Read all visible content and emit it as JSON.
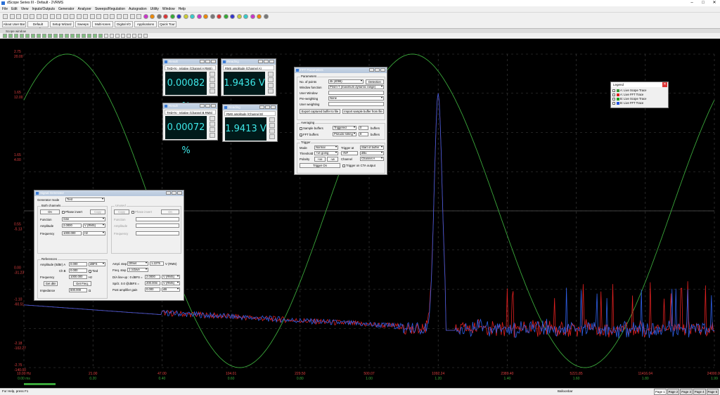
{
  "app": {
    "title": "dScope Series III - Default - 2VRMS"
  },
  "menu": [
    "File",
    "Edit",
    "View",
    "Inputs/Outputs",
    "Generator",
    "Analyzer",
    "Sweeps/Regulation",
    "Autogration",
    "Utility",
    "Window",
    "Help"
  ],
  "toolbar2": [
    "About User Bar",
    "Default Config",
    "Setup Wizard",
    "Sweeps",
    "Multi-tones",
    "Digital I/O",
    "Applications",
    "Quick Tour"
  ],
  "mdi": {
    "title": "Scope window"
  },
  "status": {
    "help": "For Help, press F1",
    "balloon": "Balloonbar",
    "pages": [
      "Page 1",
      "Page 2",
      "Page 3",
      "Page 4",
      "Page 5"
    ]
  },
  "readings": [
    {
      "title": "Result",
      "label": "THD+N - relative (Channel A RMS)",
      "value": "0.00082 %"
    },
    {
      "title": "Reading",
      "label": "RMS amplitude (Channel A)",
      "value": "1.9436 V"
    },
    {
      "title": "Result",
      "label": "THD+N - relative (Channel B RMS)",
      "value": "0.00072 %"
    },
    {
      "title": "Reading",
      "label": "RMS amplitude (Channel B)",
      "value": "1.9413 V"
    }
  ],
  "fft": {
    "title": "FFT Parameters",
    "params_label": "Parameters",
    "points_label": "No. of points",
    "points": "4k (4096)",
    "detection": "Detection",
    "window_label": "Window function",
    "window": "Prism-7 (maximum dynamic range)",
    "userwin_label": "User Window",
    "preweight_label": "Pre-weighting",
    "preweight": "None",
    "userweight_label": "User weighting",
    "export_btn": "Export captured buffer to file",
    "import_btn": "Import sample buffer from file",
    "avg_label": "Averaging",
    "sample_label": "Sample buffers",
    "sample_mode": "Triggered",
    "sample_n": "0",
    "buffers": "buffers",
    "fftbuf_label": "FFT buffers",
    "fftbuf_mode": "Pseudo-rolling",
    "fftbuf_n": "8",
    "trig_label": "Trigger",
    "mode_label": "Mode",
    "mode": "Normal",
    "trigat_label": "Trigger at",
    "trigat": "Start of buffer",
    "thresh_label": "Threshold",
    "thresh": "+ve going",
    "thresh_v": "-INF",
    "thresh_u": "dBu",
    "pol_label": "Polarity",
    "pos": "+ve",
    "neg": "-ve",
    "chan_label": "Channel",
    "chan": "Channel A",
    "trigon": "Trigger On",
    "cta": "Trigger on CTA output"
  },
  "siggen": {
    "title": "Signal Generator",
    "mode_label": "Generator mode",
    "mode": "Tied",
    "both_label": "Both channels",
    "on": "On",
    "phase": "Phase invert",
    "copy": "Copy",
    "func_label": "Function",
    "func": "Sine",
    "amp_label": "Amplitude",
    "amp": "2.0000",
    "amp_u": "V (RMS)",
    "freq_label": "Frequency",
    "freq": "1000.000",
    "freq_u": "Hz",
    "unused_label": "Unused",
    "refs_label": "References",
    "ampref_label": "Amplitude (0dBr) A",
    "ampref": "0.000",
    "ampref_u": "dBFS",
    "chb_label": "Ch B",
    "chb": "0.000",
    "tied": "Tied",
    "fref_label": "Frequency",
    "fref": "1000.000",
    "fref_u": "Hz",
    "getdbr": "Get dBr",
    "getfreq": "Get Freq.",
    "imp_label": "Impedance",
    "imp": "600.000",
    "imp_u": "Ω",
    "ampstep_label": "Ampl. step",
    "ampstep": "Offset",
    "ampstep_v": "1.2275",
    "ampstep_u": "V (RMS)",
    "freqstep_label": "Freq. step",
    "freqstep": "1 octave",
    "da_label": "D/A line-up : 0 dBFS =",
    "da": "2.0000",
    "da_u": "V (RMS)",
    "spdif_label": "Sp/iz. 0.0 @dBFS =",
    "spdif": "200.00m",
    "spdif_u": "V (RMS)",
    "post_label": "Post amplifier gain",
    "post": "0.000",
    "post_u": "dB"
  },
  "legend": {
    "title": "Legend",
    "items": [
      {
        "label": "A: Live Scope Trace",
        "color": "#3a9a3a"
      },
      {
        "label": "A: Live FFT Trace",
        "color": "#e02020"
      },
      {
        "label": "B: Live Scope Trace",
        "color": "#20a020"
      },
      {
        "label": "B: Live FFT Trace",
        "color": "#2050e0"
      }
    ]
  },
  "axes": {
    "left_top": [
      "2.75",
      "20.00"
    ],
    "left_labels": [
      [
        "1.65",
        "12.00"
      ],
      [
        "1.65",
        "4.00"
      ],
      [
        "0.55",
        "-5.13"
      ],
      [
        "0.00",
        "-31.23"
      ],
      [
        "-1.10",
        "-60.51"
      ],
      [
        "-2.18",
        "-102.27"
      ],
      [
        "-2.75",
        "-140.00"
      ]
    ],
    "bottom_time": [
      "0.00 ms",
      "0.20",
      "0.40",
      "0.60",
      "0.80",
      "1.00",
      "1.20",
      "1.40",
      "1.60",
      "1.80",
      "1.99"
    ],
    "bottom_freq": [
      "10.00 Hz",
      "21.00",
      "47.00",
      "104.01",
      "229.50",
      "500.07",
      "1092.24",
      "2389.40",
      "5221.85",
      "11416.04",
      "24000.00"
    ]
  },
  "chart_data": {
    "type": "line",
    "series": [
      {
        "name": "A: Live Scope Trace",
        "color": "#3a9a3a",
        "cycles": 2.0,
        "amplitude": 2.75,
        "ylim": [
          -2.75,
          2.75
        ]
      },
      {
        "name": "A: Live FFT Trace",
        "color": "#e02020",
        "ylim": [
          -140,
          20
        ]
      },
      {
        "name": "B: Live FFT Trace",
        "color": "#2050e0",
        "ylim": [
          -140,
          20
        ]
      }
    ],
    "grid": true,
    "peak_freq_hz": 1000
  }
}
